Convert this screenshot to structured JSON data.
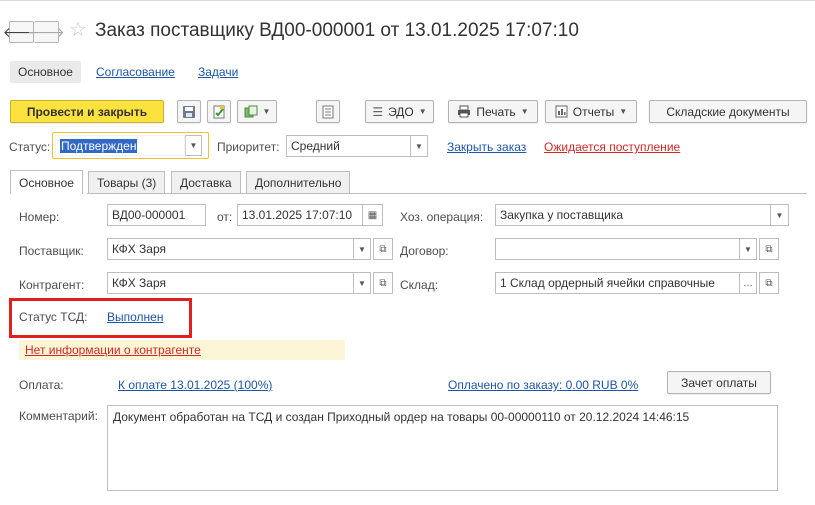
{
  "window": {
    "title": "Заказ поставщику ВД00-000001 от 13.01.2025 17:07:10",
    "nav_back_icon": "arrow-left-icon",
    "nav_forward_icon": "arrow-right-icon",
    "favorite_icon": "star-icon"
  },
  "subtabs": [
    {
      "label": "Основное",
      "active": true
    },
    {
      "label": "Согласование",
      "active": false
    },
    {
      "label": "Задачи",
      "active": false
    }
  ],
  "toolbar": {
    "post_close": "Провести и закрыть",
    "edo": "ЭДО",
    "print": "Печать",
    "reports": "Отчеты",
    "warehouse_docs": "Складские документы"
  },
  "status": {
    "status_label": "Статус:",
    "status_value": "Подтвержден",
    "priority_label": "Приоритет:",
    "priority_value": "Средний",
    "close_order": "Закрыть заказ",
    "expected_receipt": "Ожидается поступление"
  },
  "tabs": [
    {
      "label": "Основное",
      "active": true
    },
    {
      "label": "Товары (3)",
      "active": false
    },
    {
      "label": "Доставка",
      "active": false
    },
    {
      "label": "Дополнительно",
      "active": false
    }
  ],
  "form": {
    "number_label": "Номер:",
    "number_value": "ВД00-000001",
    "from_label": "от:",
    "date_value": "13.01.2025 17:07:10",
    "operation_label": "Хоз. операция:",
    "operation_value": "Закупка у поставщика",
    "supplier_label": "Поставщик:",
    "supplier_value": "КФХ Заря",
    "contract_label": "Договор:",
    "contract_value": "",
    "counterparty_label": "Контрагент:",
    "counterparty_value": "КФХ Заря",
    "warehouse_label": "Склад:",
    "warehouse_value": "1 Склад ордерный ячейки справочные",
    "tsd_label": "Статус ТСД:",
    "tsd_value": "Выполнен",
    "no_info": "Нет информации о контрагенте",
    "payment_label": "Оплата:",
    "payment_link": "К оплате 13.01.2025 (100%)",
    "paid_link": "Оплачено по заказу: 0.00 RUB 0%",
    "offset_button": "Зачет оплаты",
    "comment_label": "Комментарий:",
    "comment_value": "Документ обработан на ТСД и создан Приходный ордер на товары 00-00000110 от 20.12.2024 14:46:15"
  },
  "colors": {
    "primary_button": "#fce23f",
    "link": "#1c56a8",
    "red_link": "#d32727",
    "highlight_box": "#e02020",
    "warning_bg": "#fdf6d6",
    "focus_border": "#f0c030"
  }
}
